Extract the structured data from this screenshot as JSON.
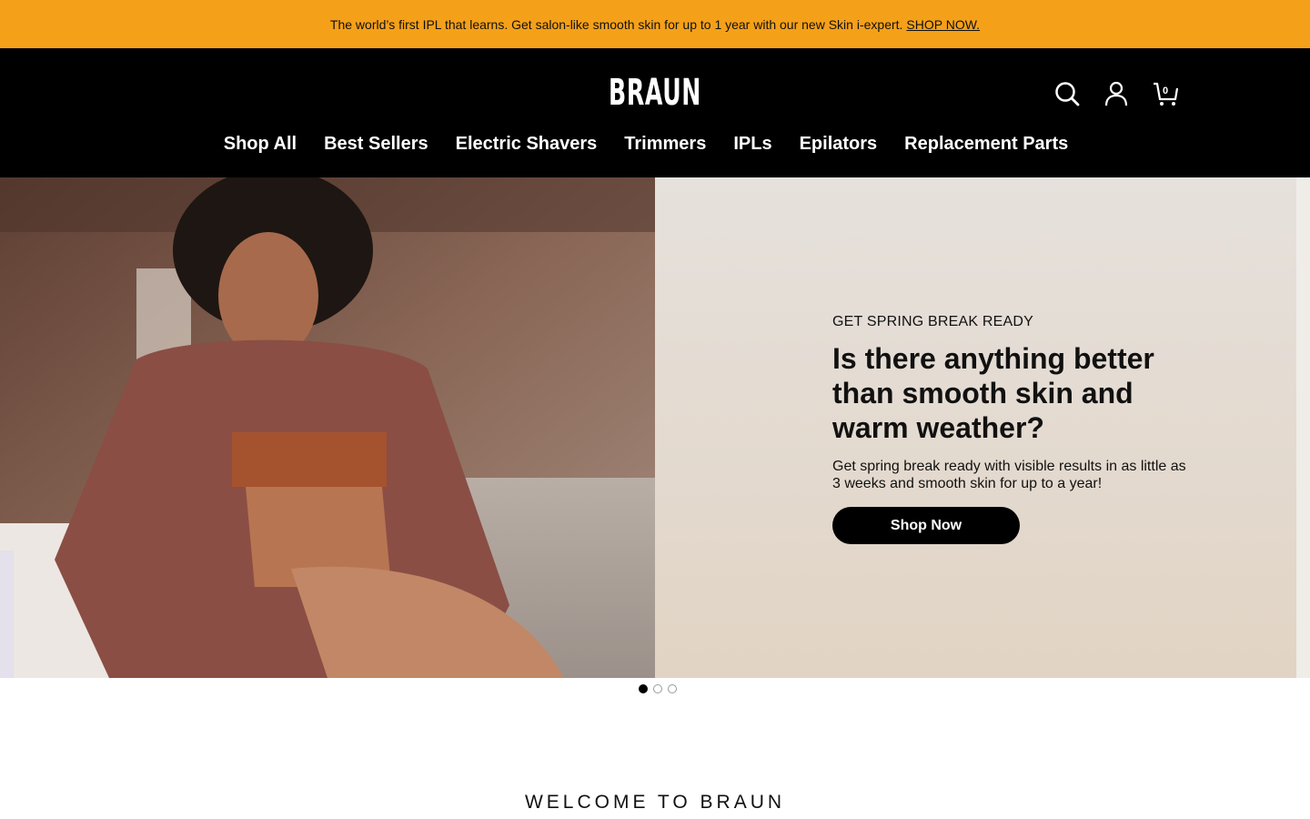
{
  "promo": {
    "text": "The world’s first IPL that learns. Get salon-like smooth skin for up to 1 year with our new Skin i-expert.",
    "link": "SHOP NOW."
  },
  "header": {
    "logo": "BRAUN",
    "cart_count": "0",
    "icons": [
      "search-icon",
      "account-icon",
      "cart-icon"
    ]
  },
  "nav": {
    "items": [
      "Shop All",
      "Best Sellers",
      "Electric Shavers",
      "Trimmers",
      "IPLs",
      "Epilators",
      "Replacement Parts"
    ]
  },
  "hero": {
    "eyebrow": "GET SPRING BREAK READY",
    "headline": "Is there anything better than smooth skin and warm weather?",
    "body": "Get spring break ready with visible results in as little as 3 weeks and smooth skin for up to a year!",
    "cta": "Shop Now",
    "slides_total": 3,
    "active_slide": 1
  },
  "welcome": "WELCOME TO BRAUN",
  "colors": {
    "promo_bg": "#f5a019",
    "header_bg": "#000000",
    "cta_bg": "#000000"
  }
}
